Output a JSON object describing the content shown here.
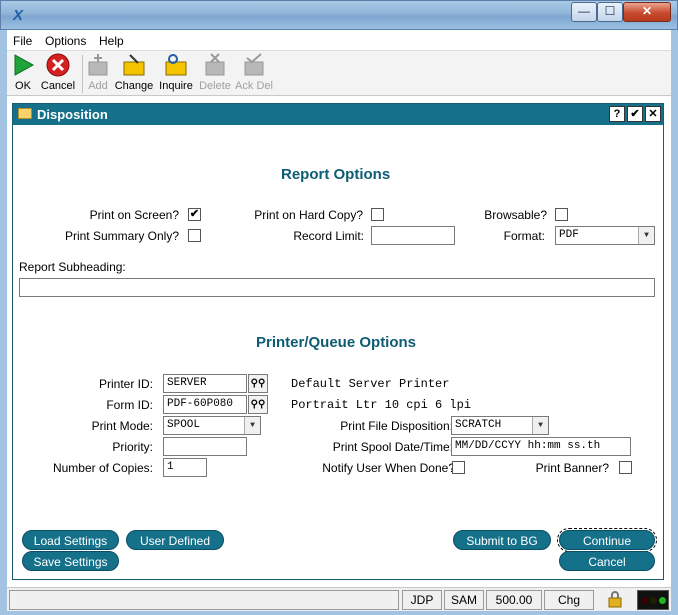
{
  "window": {
    "app_icon": "x-app-icon",
    "controls": {
      "minimize": "—",
      "maximize": "☐",
      "close": "✕"
    }
  },
  "menu": {
    "items": [
      "File",
      "Options",
      "Help"
    ]
  },
  "toolbar": {
    "ok": "OK",
    "cancel": "Cancel",
    "add": "Add",
    "change": "Change",
    "inquire": "Inquire",
    "delete": "Delete",
    "ack_del": "Ack Del"
  },
  "dialog": {
    "title": "Disposition",
    "help_btn": "?",
    "check_btn": "✔",
    "close_btn": "✕"
  },
  "report_options": {
    "title": "Report Options",
    "print_on_screen": {
      "label": "Print on Screen?",
      "checked": true
    },
    "print_hard_copy": {
      "label": "Print on Hard Copy?",
      "checked": false
    },
    "browsable": {
      "label": "Browsable?",
      "checked": false
    },
    "print_summary_only": {
      "label": "Print Summary Only?",
      "checked": false
    },
    "record_limit": {
      "label": "Record Limit:",
      "value": ""
    },
    "format": {
      "label": "Format:",
      "value": "PDF"
    },
    "subheading": {
      "label": "Report Subheading:",
      "value": ""
    }
  },
  "printer_options": {
    "title": "Printer/Queue Options",
    "printer_id": {
      "label": "Printer ID:",
      "value": "SERVER",
      "description": "Default Server Printer"
    },
    "form_id": {
      "label": "Form ID:",
      "value": "PDF-60P080",
      "description": "Portrait Ltr 10 cpi 6 lpi"
    },
    "print_mode": {
      "label": "Print Mode:",
      "value": "SPOOL"
    },
    "priority": {
      "label": "Priority:",
      "value": ""
    },
    "copies": {
      "label": "Number of Copies:",
      "value": "1"
    },
    "file_disposition": {
      "label": "Print File Disposition:",
      "value": "SCRATCH"
    },
    "spool_datetime": {
      "label": "Print Spool Date/Time:",
      "value": "MM/DD/CCYY hh:mm ss.th"
    },
    "notify_user": {
      "label": "Notify User When Done?",
      "checked": false
    },
    "print_banner": {
      "label": "Print Banner?",
      "checked": false
    }
  },
  "buttons": {
    "load_settings": "Load Settings",
    "save_settings": "Save Settings",
    "user_defined": "User Defined",
    "submit_bg": "Submit to BG",
    "continue": "Continue",
    "cancel": "Cancel"
  },
  "status": {
    "user": "JDP",
    "company": "SAM",
    "value": "500.00",
    "mode": "Chg",
    "lights": [
      "#3a0000",
      "#1f1f00",
      "#22b322"
    ]
  }
}
